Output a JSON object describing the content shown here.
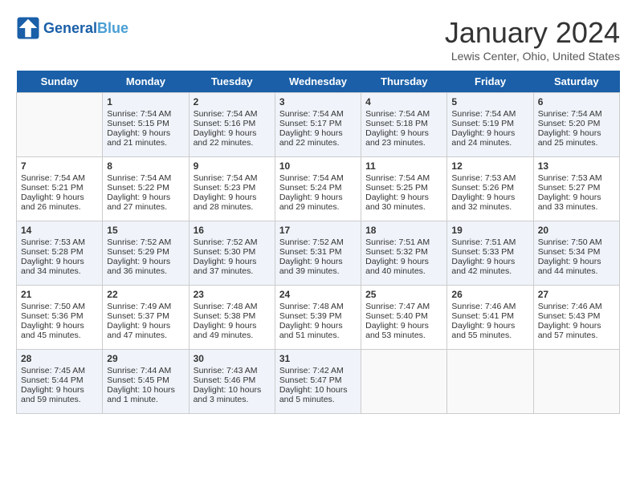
{
  "header": {
    "logo_general": "General",
    "logo_blue": "Blue",
    "month_title": "January 2024",
    "location": "Lewis Center, Ohio, United States"
  },
  "days_of_week": [
    "Sunday",
    "Monday",
    "Tuesday",
    "Wednesday",
    "Thursday",
    "Friday",
    "Saturday"
  ],
  "weeks": [
    [
      {
        "day": "",
        "info": ""
      },
      {
        "day": "1",
        "info": "Sunrise: 7:54 AM\nSunset: 5:15 PM\nDaylight: 9 hours\nand 21 minutes."
      },
      {
        "day": "2",
        "info": "Sunrise: 7:54 AM\nSunset: 5:16 PM\nDaylight: 9 hours\nand 22 minutes."
      },
      {
        "day": "3",
        "info": "Sunrise: 7:54 AM\nSunset: 5:17 PM\nDaylight: 9 hours\nand 22 minutes."
      },
      {
        "day": "4",
        "info": "Sunrise: 7:54 AM\nSunset: 5:18 PM\nDaylight: 9 hours\nand 23 minutes."
      },
      {
        "day": "5",
        "info": "Sunrise: 7:54 AM\nSunset: 5:19 PM\nDaylight: 9 hours\nand 24 minutes."
      },
      {
        "day": "6",
        "info": "Sunrise: 7:54 AM\nSunset: 5:20 PM\nDaylight: 9 hours\nand 25 minutes."
      }
    ],
    [
      {
        "day": "7",
        "info": "Sunrise: 7:54 AM\nSunset: 5:21 PM\nDaylight: 9 hours\nand 26 minutes."
      },
      {
        "day": "8",
        "info": "Sunrise: 7:54 AM\nSunset: 5:22 PM\nDaylight: 9 hours\nand 27 minutes."
      },
      {
        "day": "9",
        "info": "Sunrise: 7:54 AM\nSunset: 5:23 PM\nDaylight: 9 hours\nand 28 minutes."
      },
      {
        "day": "10",
        "info": "Sunrise: 7:54 AM\nSunset: 5:24 PM\nDaylight: 9 hours\nand 29 minutes."
      },
      {
        "day": "11",
        "info": "Sunrise: 7:54 AM\nSunset: 5:25 PM\nDaylight: 9 hours\nand 30 minutes."
      },
      {
        "day": "12",
        "info": "Sunrise: 7:53 AM\nSunset: 5:26 PM\nDaylight: 9 hours\nand 32 minutes."
      },
      {
        "day": "13",
        "info": "Sunrise: 7:53 AM\nSunset: 5:27 PM\nDaylight: 9 hours\nand 33 minutes."
      }
    ],
    [
      {
        "day": "14",
        "info": "Sunrise: 7:53 AM\nSunset: 5:28 PM\nDaylight: 9 hours\nand 34 minutes."
      },
      {
        "day": "15",
        "info": "Sunrise: 7:52 AM\nSunset: 5:29 PM\nDaylight: 9 hours\nand 36 minutes."
      },
      {
        "day": "16",
        "info": "Sunrise: 7:52 AM\nSunset: 5:30 PM\nDaylight: 9 hours\nand 37 minutes."
      },
      {
        "day": "17",
        "info": "Sunrise: 7:52 AM\nSunset: 5:31 PM\nDaylight: 9 hours\nand 39 minutes."
      },
      {
        "day": "18",
        "info": "Sunrise: 7:51 AM\nSunset: 5:32 PM\nDaylight: 9 hours\nand 40 minutes."
      },
      {
        "day": "19",
        "info": "Sunrise: 7:51 AM\nSunset: 5:33 PM\nDaylight: 9 hours\nand 42 minutes."
      },
      {
        "day": "20",
        "info": "Sunrise: 7:50 AM\nSunset: 5:34 PM\nDaylight: 9 hours\nand 44 minutes."
      }
    ],
    [
      {
        "day": "21",
        "info": "Sunrise: 7:50 AM\nSunset: 5:36 PM\nDaylight: 9 hours\nand 45 minutes."
      },
      {
        "day": "22",
        "info": "Sunrise: 7:49 AM\nSunset: 5:37 PM\nDaylight: 9 hours\nand 47 minutes."
      },
      {
        "day": "23",
        "info": "Sunrise: 7:48 AM\nSunset: 5:38 PM\nDaylight: 9 hours\nand 49 minutes."
      },
      {
        "day": "24",
        "info": "Sunrise: 7:48 AM\nSunset: 5:39 PM\nDaylight: 9 hours\nand 51 minutes."
      },
      {
        "day": "25",
        "info": "Sunrise: 7:47 AM\nSunset: 5:40 PM\nDaylight: 9 hours\nand 53 minutes."
      },
      {
        "day": "26",
        "info": "Sunrise: 7:46 AM\nSunset: 5:41 PM\nDaylight: 9 hours\nand 55 minutes."
      },
      {
        "day": "27",
        "info": "Sunrise: 7:46 AM\nSunset: 5:43 PM\nDaylight: 9 hours\nand 57 minutes."
      }
    ],
    [
      {
        "day": "28",
        "info": "Sunrise: 7:45 AM\nSunset: 5:44 PM\nDaylight: 9 hours\nand 59 minutes."
      },
      {
        "day": "29",
        "info": "Sunrise: 7:44 AM\nSunset: 5:45 PM\nDaylight: 10 hours\nand 1 minute."
      },
      {
        "day": "30",
        "info": "Sunrise: 7:43 AM\nSunset: 5:46 PM\nDaylight: 10 hours\nand 3 minutes."
      },
      {
        "day": "31",
        "info": "Sunrise: 7:42 AM\nSunset: 5:47 PM\nDaylight: 10 hours\nand 5 minutes."
      },
      {
        "day": "",
        "info": ""
      },
      {
        "day": "",
        "info": ""
      },
      {
        "day": "",
        "info": ""
      }
    ]
  ]
}
